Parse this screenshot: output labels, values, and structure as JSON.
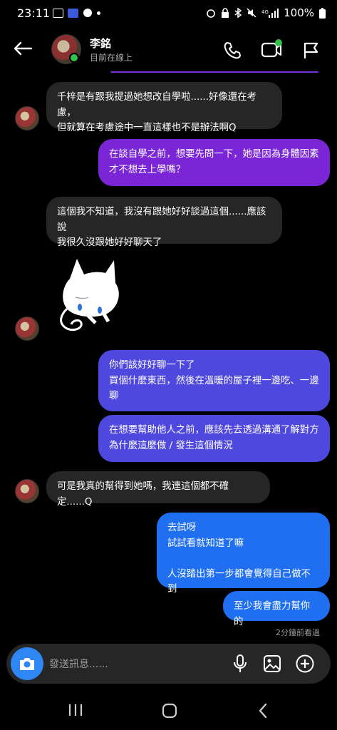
{
  "status_bar": {
    "time": "23:11",
    "battery": "100%"
  },
  "header": {
    "name": "李銘",
    "status": "目前在線上"
  },
  "messages": [
    {
      "from": "them",
      "text": "千梓是有跟我提過她想改自學啦......好像還在考慮，\n但就算在考慮途中一直這樣也不是辦法啊Q"
    },
    {
      "from": "me",
      "text": "在談自學之前，想要先問一下，她是因為身體因素\n才不想去上學嗎？"
    },
    {
      "from": "them",
      "text": "這個我不知道，我沒有跟她好好談過這個......應該說\n我很久沒跟她好好聊天了"
    },
    {
      "from": "me",
      "text": "你們該好好聊一下了\n買個什麼東西，然後在溫暖的屋子裡一邊吃、一邊\n聊"
    },
    {
      "from": "me",
      "text": "在想要幫助他人之前，應該先去透過溝通了解對方\n為什麼這麼做 / 發生這個情況"
    },
    {
      "from": "them",
      "text": "可是我真的幫得到她嗎，我連這個都不確定......Q"
    },
    {
      "from": "me",
      "text": "去試呀\n試試看就知道了嘛\n\n人沒踏出第一步都會覺得自己做不到"
    },
    {
      "from": "me",
      "text": "至少我會盡力幫你的"
    }
  ],
  "seen_text": "2分鐘前看過",
  "composer": {
    "placeholder": "發送訊息......"
  },
  "icons": {
    "back": "back-arrow-icon",
    "call": "phone-icon",
    "video": "video-icon",
    "report": "flag-icon",
    "camera": "camera-icon",
    "mic": "microphone-icon",
    "gallery": "image-icon",
    "add": "plus-icon"
  },
  "colors": {
    "bubble_in": "#262626",
    "bubble_purple": "#7a26d6",
    "bubble_indigo": "#4f48df",
    "bubble_blue": "#1f6ff0",
    "online": "#32c24b"
  }
}
